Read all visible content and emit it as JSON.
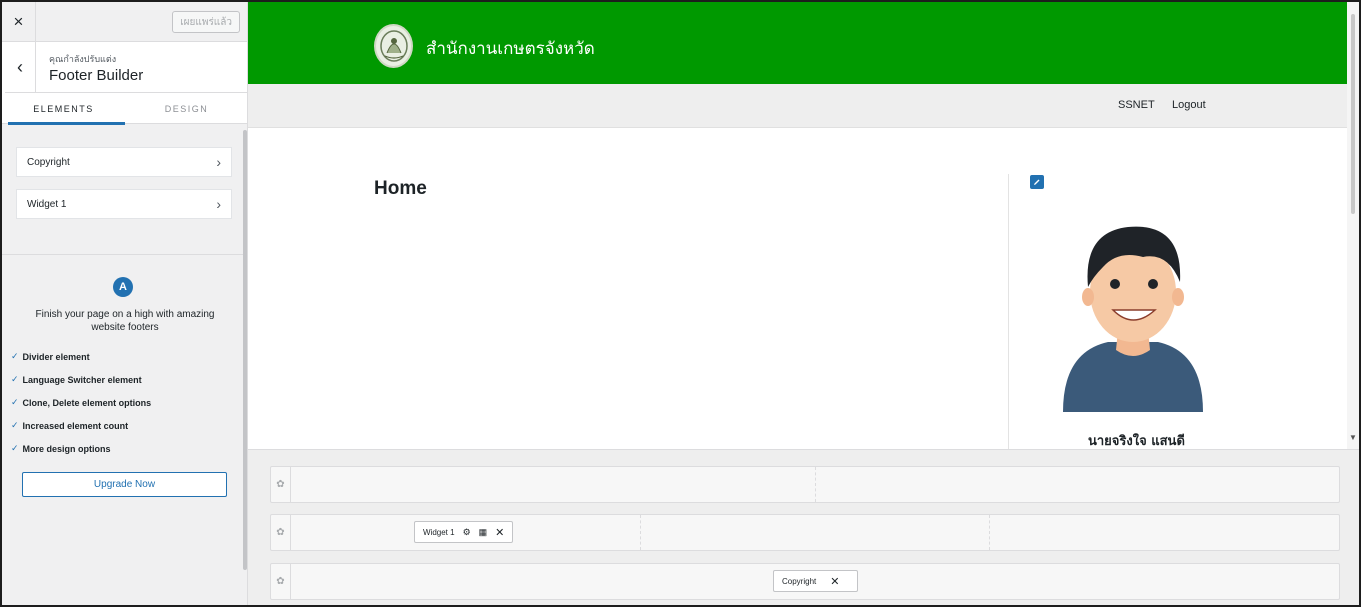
{
  "customizer": {
    "close_icon": "×",
    "publish_label": "เผยแพร่แล้ว",
    "back_icon": "‹",
    "subtitle": "คุณกำลังปรับแต่ง",
    "title": "Footer Builder",
    "tabs": [
      {
        "label": "ELEMENTS",
        "active": true
      },
      {
        "label": "DESIGN",
        "active": false
      }
    ],
    "items": [
      {
        "label": "Copyright"
      },
      {
        "label": "Widget 1"
      }
    ],
    "promo": {
      "logo_glyph": "A",
      "text": "Finish your page on a high with amazing website footers",
      "features": [
        "Divider element",
        "Language Switcher element",
        "Clone, Delete element options",
        "Increased element count",
        "More design options"
      ],
      "button_label": "Upgrade Now"
    }
  },
  "site": {
    "title": "สำนักงานเกษตรจังหวัด",
    "header_color": "#009900",
    "nav": [
      {
        "label": "SSNET"
      },
      {
        "label": "Logout"
      }
    ],
    "page_heading": "Home",
    "person_name": "นายจริงใจ แสนดี"
  },
  "builder": {
    "widget_chip_label": "Widget 1",
    "copyright_chip_label": "Copyright",
    "close_glyph": "✕",
    "settings_glyph": "✿"
  },
  "colors": {
    "accent": "#2271b1",
    "sidebar_bg": "#f0f0f1"
  }
}
